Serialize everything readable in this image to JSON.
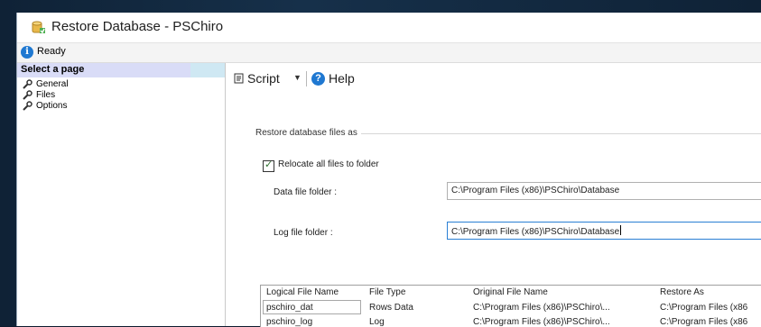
{
  "window": {
    "title": "Restore Database - PSChiro"
  },
  "status": {
    "text": "Ready"
  },
  "sidebar": {
    "header": "Select a page",
    "items": [
      {
        "label": "General"
      },
      {
        "label": "Files"
      },
      {
        "label": "Options"
      }
    ]
  },
  "toolbar": {
    "script_label": "Script",
    "help_label": "Help"
  },
  "restore_group": {
    "title": "Restore database files as",
    "relocate_label": "Relocate all files to folder",
    "relocate_checked": true,
    "data_label": "Data file folder :",
    "data_value": "C:\\Program Files (x86)\\PSChiro\\Database",
    "log_label": "Log file folder :",
    "log_value": "C:\\Program Files (x86)\\PSChiro\\Database"
  },
  "files_table": {
    "columns": [
      "Logical File Name",
      "File Type",
      "Original File Name",
      "Restore As"
    ],
    "rows": [
      [
        "pschiro_dat",
        "Rows Data",
        "C:\\Program Files (x86)\\PSChiro\\...",
        "C:\\Program Files (x86"
      ],
      [
        "pschiro_log",
        "Log",
        "C:\\Program Files (x86)\\PSChiro\\...",
        "C:\\Program Files (x86"
      ]
    ]
  },
  "colors": {
    "accent": "#1f78d1",
    "sidebar_header": "#d9dcf7",
    "focus_border": "#2a7fd4"
  },
  "icons": {
    "title": "restore-database-icon",
    "status": "info-icon",
    "nav": "wrench-icon",
    "script": "script-icon",
    "help": "help-icon"
  }
}
